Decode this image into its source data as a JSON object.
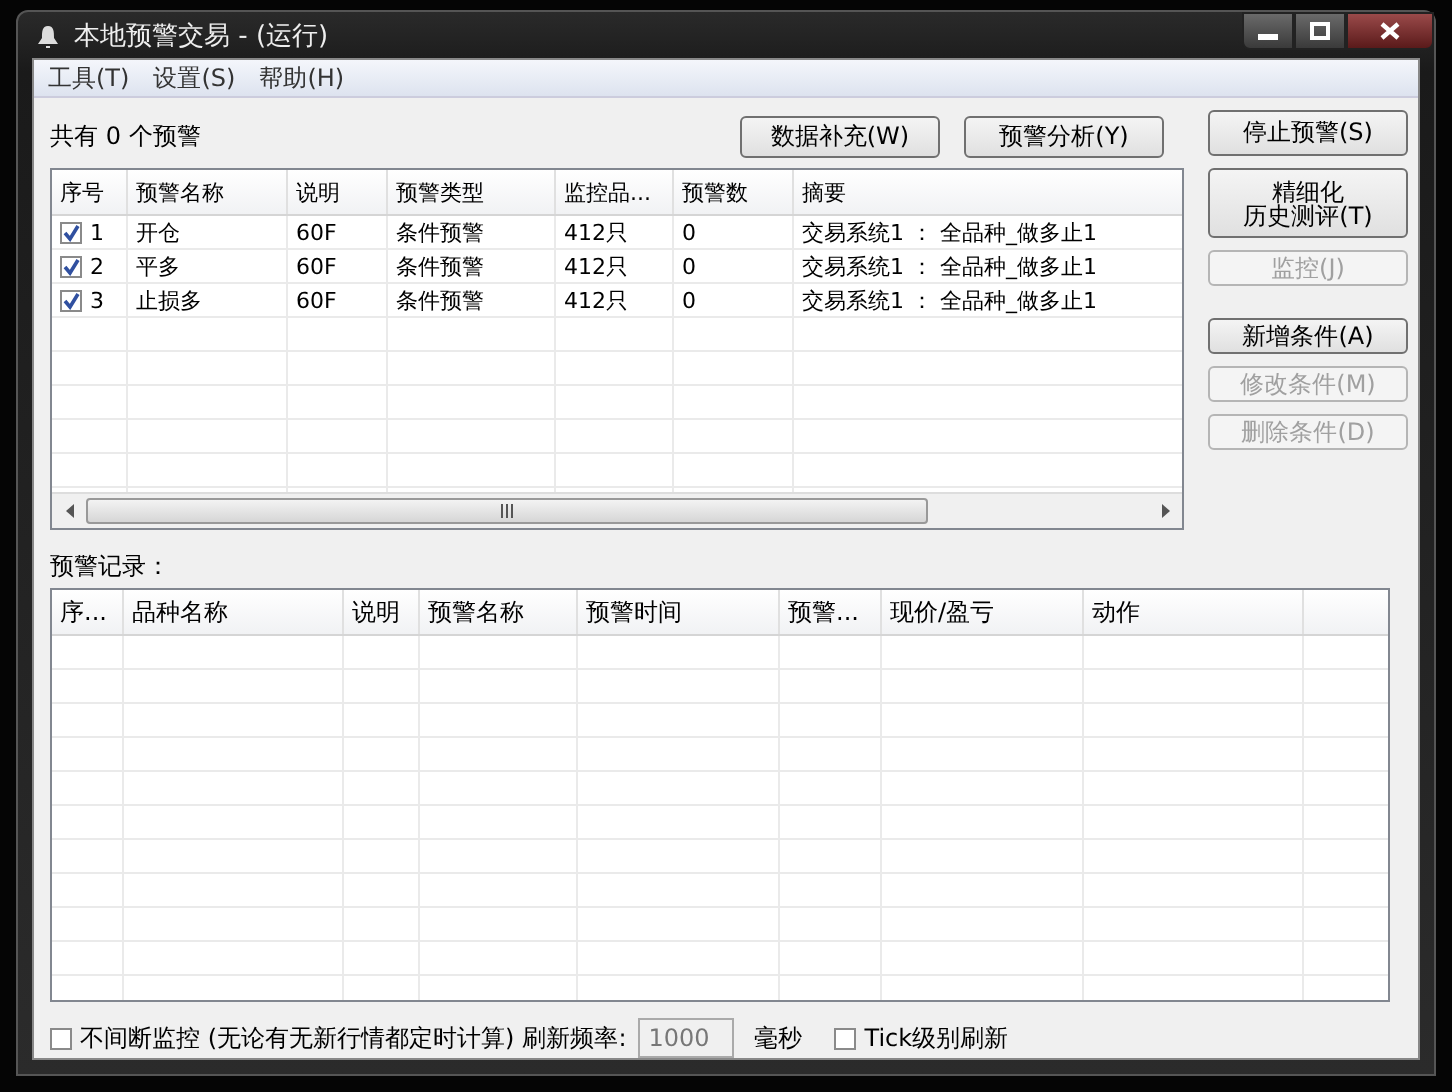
{
  "window": {
    "title": "本地预警交易  -  (运行)"
  },
  "menu": [
    {
      "label": "工具(T)"
    },
    {
      "label": "设置(S)"
    },
    {
      "label": "帮助(H)"
    }
  ],
  "alert_count": "共有 0 个预警",
  "top_buttons": [
    {
      "label": "数据补充(W)",
      "disabled": false
    },
    {
      "label": "预警分析(Y)",
      "disabled": false
    }
  ],
  "alerts_table": {
    "columns": [
      "序号",
      "预警名称",
      "说明",
      "预警类型",
      "监控品...",
      "预警数",
      "摘要"
    ],
    "rows": [
      {
        "checked": true,
        "cells": [
          "1",
          "开仓",
          "60F",
          "条件预警",
          "412只",
          "0",
          "交易系统1 ： 全品种_做多止1"
        ]
      },
      {
        "checked": true,
        "cells": [
          "2",
          "平多",
          "60F",
          "条件预警",
          "412只",
          "0",
          "交易系统1 ： 全品种_做多止1"
        ]
      },
      {
        "checked": true,
        "cells": [
          "3",
          "止损多",
          "60F",
          "条件预警",
          "412只",
          "0",
          "交易系统1 ： 全品种_做多止1"
        ]
      }
    ]
  },
  "side_buttons": [
    {
      "lines": [
        "停止预警(S)"
      ],
      "disabled": false
    },
    {
      "lines": [
        "精细化",
        "历史测评(T)"
      ],
      "disabled": false
    },
    {
      "lines": [
        "监控(J)"
      ],
      "disabled": true
    },
    {
      "lines": [
        "新增条件(A)"
      ],
      "disabled": false
    },
    {
      "lines": [
        "修改条件(M)"
      ],
      "disabled": true
    },
    {
      "lines": [
        "删除条件(D)"
      ],
      "disabled": true
    }
  ],
  "log_label": "预警记录：",
  "log_table": {
    "columns": [
      "序...",
      "品种名称",
      "说明",
      "预警名称",
      "预警时间",
      "预警...",
      "现价/盈亏",
      "动作"
    ]
  },
  "footer": {
    "continuous": {
      "label": "不间断监控 (无论有无新行情都定时计算)",
      "checked": false
    },
    "refresh_label": "刷新频率:",
    "refresh_field": {
      "value": "1000",
      "disabled": true
    },
    "unit": "毫秒",
    "tick": {
      "label": "Tick级别刷新",
      "checked": false
    }
  }
}
